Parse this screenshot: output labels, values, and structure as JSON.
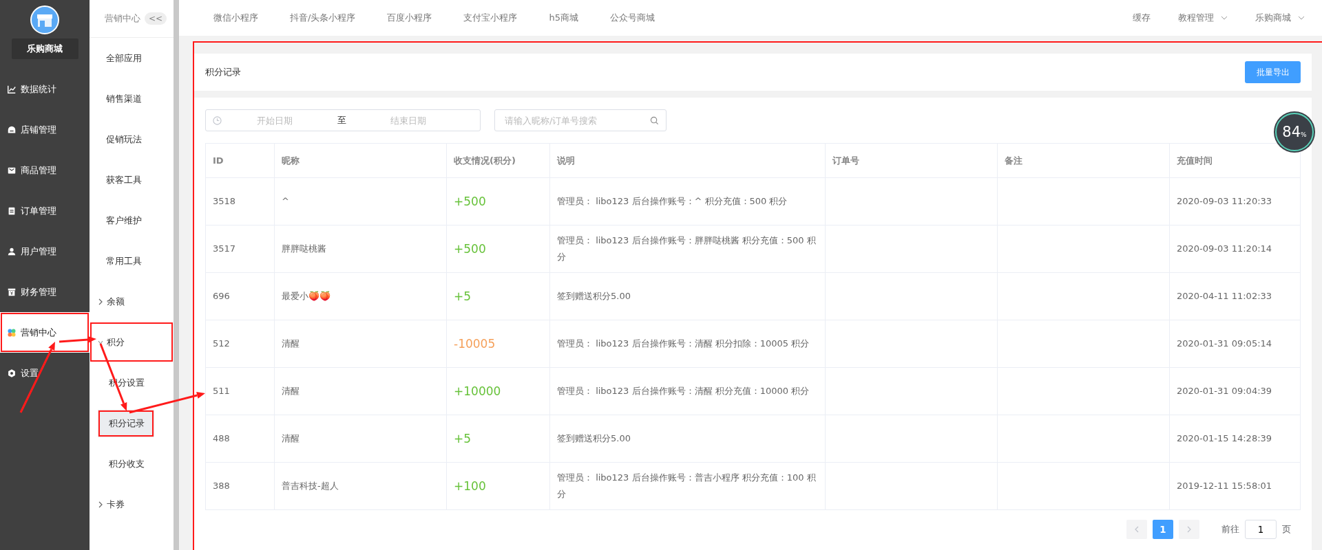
{
  "brand": {
    "name": "乐购商城"
  },
  "sidebar": {
    "items": [
      {
        "label": "数据统计",
        "selected": false,
        "highlighted": false
      },
      {
        "label": "店铺管理",
        "selected": false,
        "highlighted": false
      },
      {
        "label": "商品管理",
        "selected": false,
        "highlighted": false
      },
      {
        "label": "订单管理",
        "selected": false,
        "highlighted": false
      },
      {
        "label": "用户管理",
        "selected": false,
        "highlighted": false
      },
      {
        "label": "财务管理",
        "selected": false,
        "highlighted": false
      },
      {
        "label": "营销中心",
        "selected": true,
        "highlighted": true
      },
      {
        "label": "设置",
        "selected": false,
        "highlighted": false
      }
    ]
  },
  "submenu": {
    "title": "营销中心",
    "collapse": "<<",
    "items": [
      {
        "label": "全部应用",
        "selected": false,
        "highlighted": false
      },
      {
        "label": "销售渠道",
        "selected": false,
        "highlighted": false
      },
      {
        "label": "促销玩法",
        "selected": false,
        "highlighted": false
      },
      {
        "label": "获客工具",
        "selected": false,
        "highlighted": false
      },
      {
        "label": "客户维护",
        "selected": false,
        "highlighted": false
      },
      {
        "label": "常用工具",
        "selected": false,
        "highlighted": false
      },
      {
        "label": "余额",
        "kind": "group",
        "expanded": false,
        "highlighted": false
      },
      {
        "label": "积分",
        "kind": "group",
        "expanded": true,
        "highlighted": true,
        "children": [
          {
            "label": "积分设置",
            "selected": false,
            "highlighted": false
          },
          {
            "label": "积分记录",
            "selected": true,
            "highlighted": true
          },
          {
            "label": "积分收支",
            "selected": false,
            "highlighted": false
          }
        ]
      },
      {
        "label": "卡券",
        "kind": "group",
        "expanded": false,
        "highlighted": false
      }
    ]
  },
  "top_tabs": [
    "微信小程序",
    "抖音/头条小程序",
    "百度小程序",
    "支付宝小程序",
    "h5商城",
    "公众号商城"
  ],
  "top_right": [
    {
      "label": "缓存",
      "dropdown": false
    },
    {
      "label": "教程管理",
      "dropdown": true
    },
    {
      "label": "乐购商城",
      "dropdown": true
    }
  ],
  "panel": {
    "highlighted": true,
    "title": "积分记录",
    "export_button": "批量导出",
    "date_range": {
      "start_placeholder": "开始日期",
      "separator": "至",
      "end_placeholder": "结束日期"
    },
    "search": {
      "placeholder": "请输入昵称/订单号搜索"
    },
    "table": {
      "columns": [
        "ID",
        "昵称",
        "收支情况(积分)",
        "说明",
        "订单号",
        "备注",
        "充值时间"
      ],
      "rows": [
        {
          "id": "3518",
          "nickname": "^",
          "amount": "+500",
          "kind": "income",
          "description": "管理员： libo123 后台操作账号：^ 积分充值：500 积分",
          "order_no": "",
          "remark": "",
          "time": "2020-09-03 11:20:33"
        },
        {
          "id": "3517",
          "nickname": "胖胖哒桃酱",
          "amount": "+500",
          "kind": "income",
          "description": "管理员： libo123 后台操作账号：胖胖哒桃酱 积分充值：500 积分",
          "order_no": "",
          "remark": "",
          "time": "2020-09-03 11:20:14"
        },
        {
          "id": "696",
          "nickname": "最爱小🍑🍑",
          "amount": "+5",
          "kind": "income",
          "description": "签到赠送积分5.00",
          "order_no": "",
          "remark": "",
          "time": "2020-04-11 11:02:33"
        },
        {
          "id": "512",
          "nickname": "清醒",
          "amount": "-10005",
          "kind": "expense",
          "description": "管理员： libo123 后台操作账号：清醒 积分扣除：10005 积分",
          "order_no": "",
          "remark": "",
          "time": "2020-01-31 09:05:14"
        },
        {
          "id": "511",
          "nickname": "清醒",
          "amount": "+10000",
          "kind": "income",
          "description": "管理员： libo123 后台操作账号：清醒 积分充值：10000 积分",
          "order_no": "",
          "remark": "",
          "time": "2020-01-31 09:04:39"
        },
        {
          "id": "488",
          "nickname": "清醒",
          "amount": "+5",
          "kind": "income",
          "description": "签到赠送积分5.00",
          "order_no": "",
          "remark": "",
          "time": "2020-01-15 14:28:39"
        },
        {
          "id": "388",
          "nickname": "普吉科技-超人",
          "amount": "+100",
          "kind": "income",
          "description": "管理员： libo123 后台操作账号：普吉小程序 积分充值：100 积分",
          "order_no": "",
          "remark": "",
          "time": "2019-12-11 15:58:01"
        }
      ]
    },
    "pagination": {
      "pages": [
        {
          "label": "1",
          "selected": true
        }
      ],
      "goto_label": "前往",
      "goto_value": "1",
      "page_unit": "页"
    }
  },
  "speed_badge": {
    "reading": "84",
    "unit": "%"
  }
}
